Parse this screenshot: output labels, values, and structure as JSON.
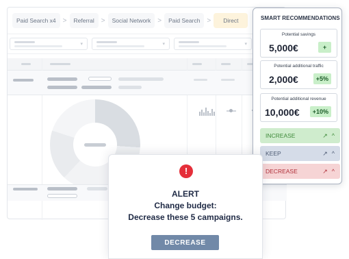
{
  "breadcrumb": {
    "items": [
      {
        "label": "Paid Search x4"
      },
      {
        "label": "Referral"
      },
      {
        "label": "Social Network"
      },
      {
        "label": "Paid Search"
      },
      {
        "label": "Direct"
      }
    ],
    "separator": ">"
  },
  "filters": {
    "chevron": "▾"
  },
  "recommendations": {
    "title": "SMART RECOMMENDATIONS",
    "cards": [
      {
        "label": "Potential savings",
        "value": "5,000€",
        "badge": "+"
      },
      {
        "label": "Potential additional traffic",
        "value": "2,000€",
        "badge": "+5%"
      },
      {
        "label": "Potential additional revenue",
        "value": "10,000€",
        "badge": "+10%"
      }
    ],
    "actions": [
      {
        "label": "INCREASE",
        "icons": [
          "external-link-icon",
          "chevron-up-icon"
        ]
      },
      {
        "label": "KEEP",
        "icons": [
          "external-link-icon",
          "chevron-up-icon"
        ]
      },
      {
        "label": "DECREASE",
        "icons": [
          "external-link-icon",
          "chevron-up-icon"
        ]
      }
    ],
    "icon_glyphs": {
      "external_link": "↗",
      "chevron_up": "^"
    }
  },
  "alert": {
    "icon": "!",
    "title": "ALERT",
    "line1": "Change budget:",
    "line2": "Decrease these 5 campaigns.",
    "button_label": "DECREASE"
  },
  "colors": {
    "increase_bg": "#cfeccd",
    "keep_bg": "#d5dce8",
    "decrease_bg": "#f6d4d5",
    "badge_bg": "#c9efc9",
    "alert_red": "#e52f3a",
    "button_bg": "#7189a8",
    "active_crumb_bg": "#fdf3dc"
  }
}
